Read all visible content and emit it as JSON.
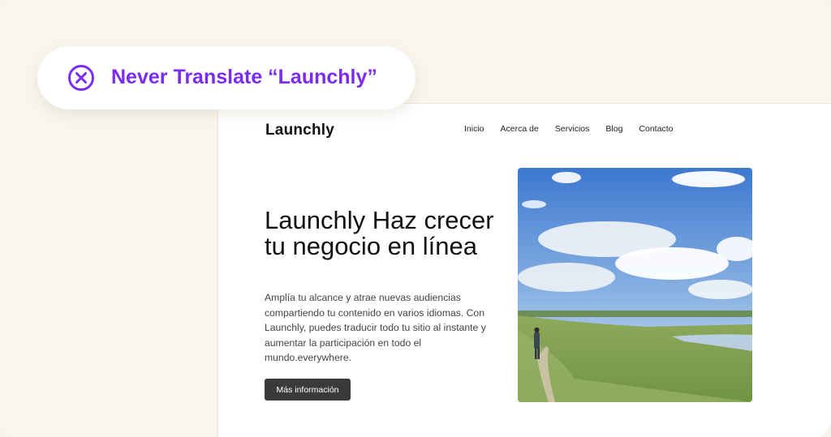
{
  "site": {
    "brand": "Launchly",
    "nav": [
      "Inicio",
      "Acerca de",
      "Servicios",
      "Blog",
      "Contacto"
    ],
    "hero_title": "Launchly Haz crecer tu negocio en línea",
    "hero_body": "Amplía tu alcance y atrae nuevas audiencias compartiendo tu contenido en varios idiomas.  Con Launchly, puedes traducir todo tu sitio al instante y aumentar la participación en todo el mundo.everywhere.",
    "cta_label": "Más información",
    "hero_image_icon": "landscape-photo"
  },
  "callout": {
    "icon": "circle-x-icon",
    "text": "Never Translate “Launchly”",
    "accent_color": "#7b2cf0"
  }
}
